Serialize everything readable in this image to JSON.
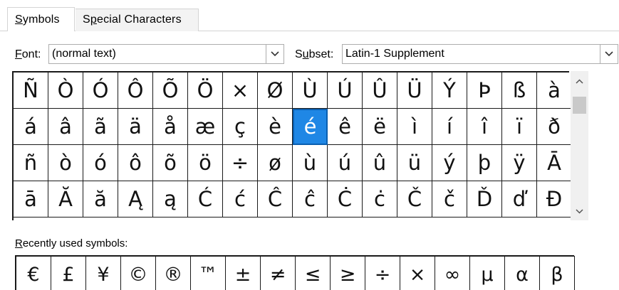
{
  "tabs": [
    {
      "label": "Symbols",
      "mnemonic_index": 0,
      "active": true
    },
    {
      "label": "Special Characters",
      "mnemonic_index": 1,
      "active": false
    }
  ],
  "font": {
    "label": "Font:",
    "mnemonic_index": 0,
    "value": "(normal text)"
  },
  "subset": {
    "label": "Subset:",
    "mnemonic_index": 1,
    "value": "Latin-1 Supplement"
  },
  "symbol_grid": {
    "rows": [
      [
        "Ñ",
        "Ò",
        "Ó",
        "Ô",
        "Õ",
        "Ö",
        "×",
        "Ø",
        "Ù",
        "Ú",
        "Û",
        "Ü",
        "Ý",
        "Þ",
        "ß",
        "à"
      ],
      [
        "á",
        "â",
        "ã",
        "ä",
        "å",
        "æ",
        "ç",
        "è",
        "é",
        "ê",
        "ë",
        "ì",
        "í",
        "î",
        "ï",
        "ð"
      ],
      [
        "ñ",
        "ò",
        "ó",
        "ô",
        "õ",
        "ö",
        "÷",
        "ø",
        "ù",
        "ú",
        "û",
        "ü",
        "ý",
        "þ",
        "ÿ",
        "Ā"
      ],
      [
        "ā",
        "Ă",
        "ă",
        "Ą",
        "ą",
        "Ć",
        "ć",
        "Ĉ",
        "ĉ",
        "Ċ",
        "ċ",
        "Č",
        "č",
        "Ď",
        "ď",
        "Đ"
      ]
    ],
    "selected": {
      "row": 1,
      "col": 8
    }
  },
  "recent": {
    "label": "Recently used symbols:",
    "mnemonic_index": 0,
    "symbols": [
      "€",
      "£",
      "¥",
      "©",
      "®",
      "™",
      "±",
      "≠",
      "≤",
      "≥",
      "÷",
      "×",
      "∞",
      "µ",
      "α",
      "β"
    ]
  },
  "icons": {
    "dropdown": "chevron-down-icon",
    "scroll_up": "scroll-up-arrow-icon",
    "scroll_down": "scroll-down-arrow-icon"
  },
  "colors": {
    "selection_bg": "#1f87e5",
    "selection_fg": "#ffffff",
    "grid_line": "#1a1a1a"
  }
}
